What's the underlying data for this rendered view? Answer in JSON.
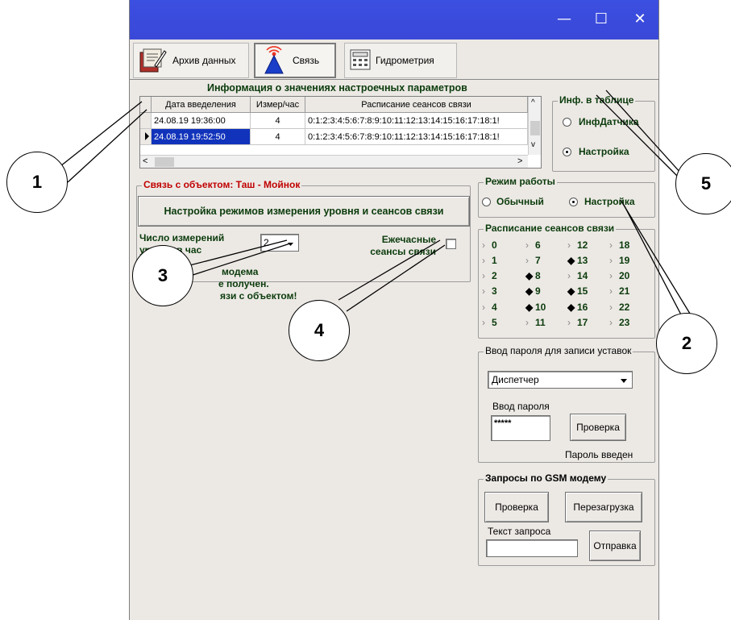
{
  "window": {
    "controls": {
      "minimize": "—",
      "maximize": "☐",
      "close": "✕"
    }
  },
  "tabs": [
    {
      "label": "Архив данных",
      "icon": "archive-icon"
    },
    {
      "label": "Связь",
      "icon": "antenna-icon"
    },
    {
      "label": "Гидрометрия",
      "icon": "calculator-icon"
    }
  ],
  "info": {
    "heading": "Информация о значениях настроечных параметров",
    "columns": [
      "Дата введеления",
      "Измер/час",
      "Расписание сеансов связи"
    ],
    "rows": [
      [
        "24.08.19 19:36:00",
        "4",
        "0:1:2:3:4:5:6:7:8:9:10:11:12:13:14:15:16:17:18:1!"
      ],
      [
        "24.08.19 19:52:50",
        "4",
        "0:1:2:3:4:5:6:7:8:9:10:11:12:13:14:15:16:17:18:1!"
      ]
    ],
    "selected_row": 1
  },
  "table_info": {
    "title": "Инф. в таблице",
    "options": [
      "ИнфДатчика",
      "Настройка"
    ],
    "selected": 1
  },
  "connection": {
    "title": "Связь с объектом: Таш - Мойнок",
    "setup_button": "Настройка режимов измерения уровня и сеансов связи",
    "measurements_label_1": "Число измерений",
    "measurements_label_2": "уровня в час",
    "measurements_value": "2",
    "hourly_label_1": "Ежечасные",
    "hourly_label_2": "сеансы связи",
    "status_lines": [
      "модема",
      "е получен.",
      "язи с объектом!"
    ]
  },
  "mode": {
    "title": "Режим работы",
    "options": [
      "Обычный",
      "Настройка"
    ],
    "selected": 1
  },
  "schedule": {
    "title": "Расписание сеансов связи",
    "hours": [
      "0",
      "1",
      "2",
      "3",
      "4",
      "5",
      "6",
      "7",
      "8",
      "9",
      "10",
      "11",
      "12",
      "13",
      "14",
      "15",
      "16",
      "17",
      "18",
      "19",
      "20",
      "21",
      "22",
      "23"
    ],
    "active": [
      "8",
      "9",
      "10",
      "13",
      "15",
      "16"
    ]
  },
  "password": {
    "title": "Ввод пароля для записи уставок",
    "role": "Диспетчер",
    "input_label": "Ввод пароля",
    "value": "*****",
    "check_button": "Проверка",
    "status": "Пароль введен"
  },
  "gsm": {
    "title": "Запросы по GSM модему",
    "check_button": "Проверка",
    "reboot_button": "Перезагрузка",
    "text_label": "Текст запроса",
    "text_value": "",
    "send_button": "Отправка"
  },
  "callouts": [
    "1",
    "2",
    "3",
    "4",
    "5"
  ]
}
